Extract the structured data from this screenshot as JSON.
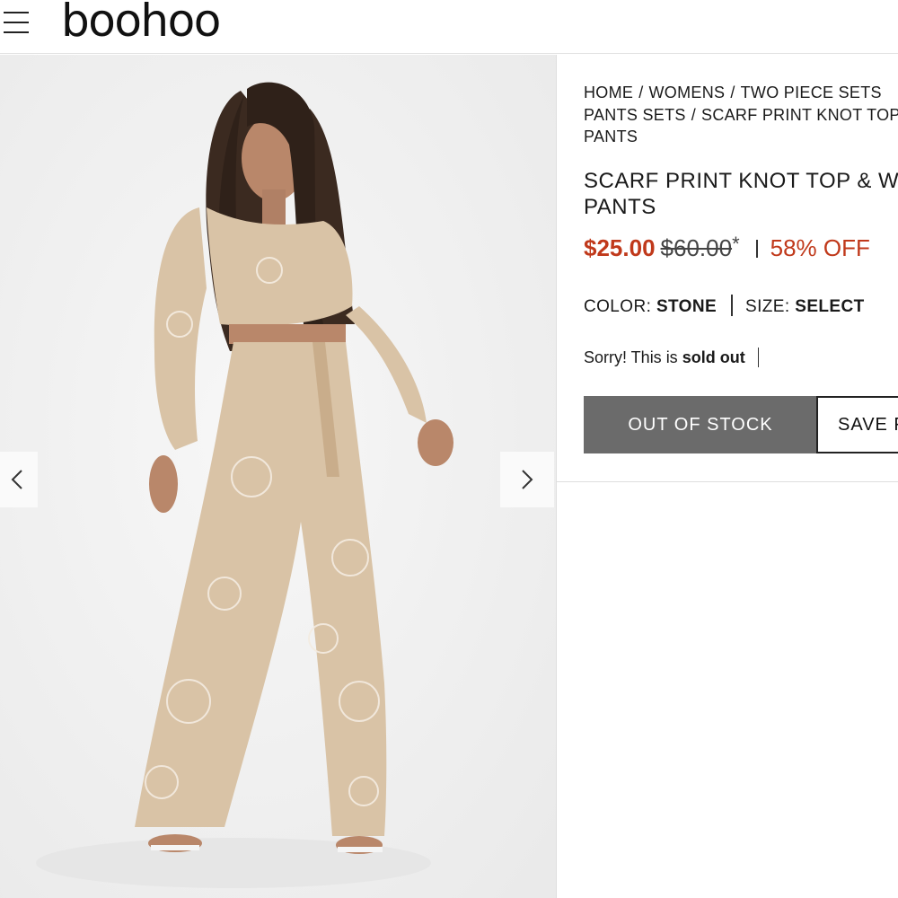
{
  "header": {
    "logo_text": "boohoo",
    "menu_icon": "hamburger-menu-icon"
  },
  "gallery": {
    "prev_icon": "chevron-left-icon",
    "next_icon": "chevron-right-icon"
  },
  "breadcrumb": {
    "items": [
      "HOME",
      "WOMENS",
      "TWO PIECE SETS",
      "PANTS SETS",
      "SCARF PRINT KNOT TOP"
    ],
    "trail_overflow": "PANTS",
    "separator": "/"
  },
  "product": {
    "title_line1": "SCARF PRINT KNOT TOP & W",
    "title_line2": "PANTS",
    "price_now": "$25.00",
    "price_was": "$60.00",
    "price_note": "*",
    "discount": "58% OFF",
    "color_label": "COLOR:",
    "color_value": "STONE",
    "size_label": "SIZE:",
    "size_value": "SELECT",
    "sold_out_prefix": "Sorry! This is",
    "sold_out_strong": "sold out"
  },
  "buttons": {
    "out_of_stock": "OUT OF STOCK",
    "save": "SAVE F"
  },
  "colors": {
    "price_red": "#c0391b",
    "button_grey": "#6b6b6b",
    "fabric": "#d6bfa3"
  }
}
